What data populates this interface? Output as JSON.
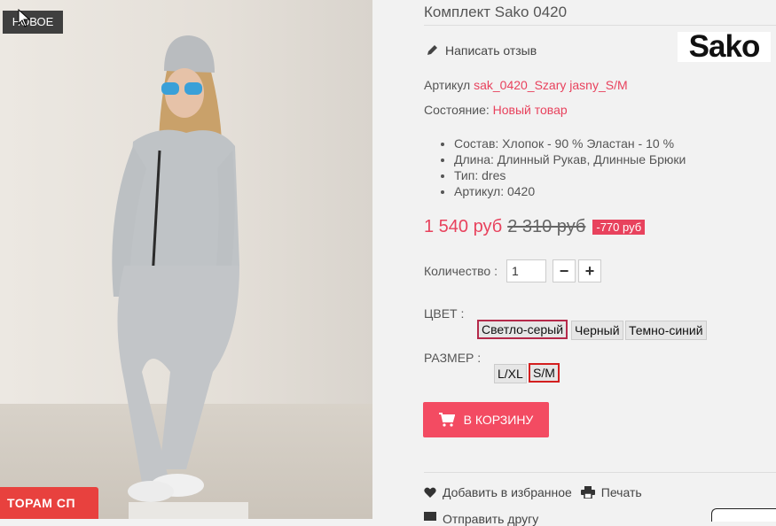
{
  "photo": {
    "badge_new": "НОВОЕ",
    "promo_label": "ТОРАМ СП"
  },
  "product": {
    "title": "Комплект Sako 0420",
    "review_link": "Написать отзыв",
    "brand_logo": "Sako",
    "sku_label": "Артикул",
    "sku_value": "sak_0420_Szary jasny_S/M",
    "condition_label": "Состояние:",
    "condition_value": "Новый товар",
    "specs": [
      "Состав: Хлопок - 90 % Эластан - 10 %",
      "Длина: Длинный Рукав, Длинные Брюки",
      "Тип: dres",
      "Артикул: 0420"
    ],
    "price": "1 540 руб",
    "old_price": "2 310 руб",
    "discount": "-770 руб",
    "quantity_label": "Количество :",
    "quantity_value": "1",
    "minus": "−",
    "plus": "+",
    "color_label": "ЦВЕТ :",
    "colors": [
      "Светло-серый",
      "Черный",
      "Темно-синий"
    ],
    "selected_color": "Светло-серый",
    "size_label": "РАЗМЕР :",
    "sizes": [
      "L/XL",
      "S/M"
    ],
    "selected_size": "S/M",
    "add_to_cart": "В КОРЗИНУ",
    "wishlist": "Добавить в избранное",
    "print": "Печать",
    "send_friend": "Отправить другу"
  },
  "colors": {
    "accent": "#e8425d",
    "cart_button": "#f34b62",
    "badge_bg": "#3f3f3f",
    "promo_bg": "#e8413e"
  }
}
